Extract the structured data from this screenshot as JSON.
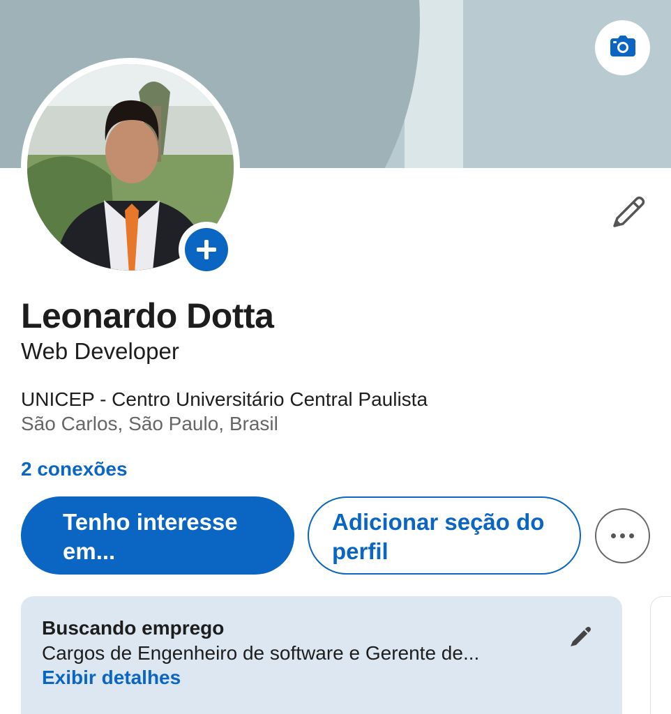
{
  "profile": {
    "name": "Leonardo Dotta",
    "headline": "Web Developer",
    "education": "UNICEP - Centro Universitário Central Paulista",
    "location": "São Carlos, São Paulo, Brasil",
    "connections": "2 conexões"
  },
  "actions": {
    "primary_label": "Tenho interesse em...",
    "secondary_label": "Adicionar seção do perfil",
    "more_icon": "ellipsis-icon"
  },
  "open_to_work": {
    "title": "Buscando emprego",
    "description": "Cargos de Engenheiro de software e Gerente de...",
    "link": "Exibir detalhes"
  },
  "icons": {
    "banner_edit": "camera-icon",
    "photo_add": "plus-icon",
    "intro_edit": "pencil-icon",
    "card_edit": "pencil-icon"
  },
  "colors": {
    "brand_blue": "#0a66c2",
    "banner": "#9fb2b7",
    "card_bg": "#dde7f1"
  }
}
